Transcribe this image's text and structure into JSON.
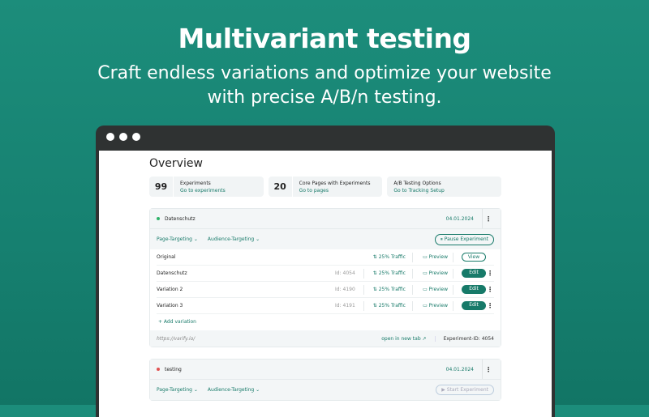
{
  "hero": {
    "title": "Multivariant testing",
    "subtitle": "Craft endless variations and optimize your website with precise A/B/n testing."
  },
  "overview": {
    "title": "Overview",
    "stats": [
      {
        "num": "99",
        "label": "Experiments",
        "link": "Go to experiments"
      },
      {
        "num": "20",
        "label": "Core Pages with Experiments",
        "link": "Go to pages"
      },
      {
        "num": "",
        "label": "A/B Testing Options",
        "link": "Go to Tracking Setup"
      }
    ]
  },
  "experiments": [
    {
      "name": "Datenschutz",
      "status_color": "#2fb36a",
      "date": "04.01.2024",
      "page_targeting": "Page-Targeting ⌄",
      "audience_targeting": "Audience-Targeting ⌄",
      "action": "⏸ Pause Experiment",
      "variations": [
        {
          "name": "Original",
          "id_label": "",
          "id": "",
          "traffic": "⇅ 25% Traffic",
          "preview": "▭ Preview",
          "button": "View"
        },
        {
          "name": "Datenschutz",
          "id_label": "Id:",
          "id": "4054",
          "traffic": "⇅ 25% Traffic",
          "preview": "▭ Preview",
          "button": "Edit"
        },
        {
          "name": "Variation 2",
          "id_label": "Id:",
          "id": "4190",
          "traffic": "⇅ 25% Traffic",
          "preview": "▭ Preview",
          "button": "Edit"
        },
        {
          "name": "Variation 3",
          "id_label": "Id:",
          "id": "4191",
          "traffic": "⇅ 25% Traffic",
          "preview": "▭ Preview",
          "button": "Edit"
        }
      ],
      "add_variation": "+ Add variation",
      "url": "https://varify.io/",
      "open_tab": "open in new tab ↗",
      "experiment_id": "Experiment-ID: 4054"
    },
    {
      "name": "testing",
      "status_color": "#e05252",
      "date": "04.01.2024",
      "page_targeting": "Page-Targeting ⌄",
      "audience_targeting": "Audience-Targeting ⌄",
      "action": "▶ Start Experiment"
    }
  ]
}
